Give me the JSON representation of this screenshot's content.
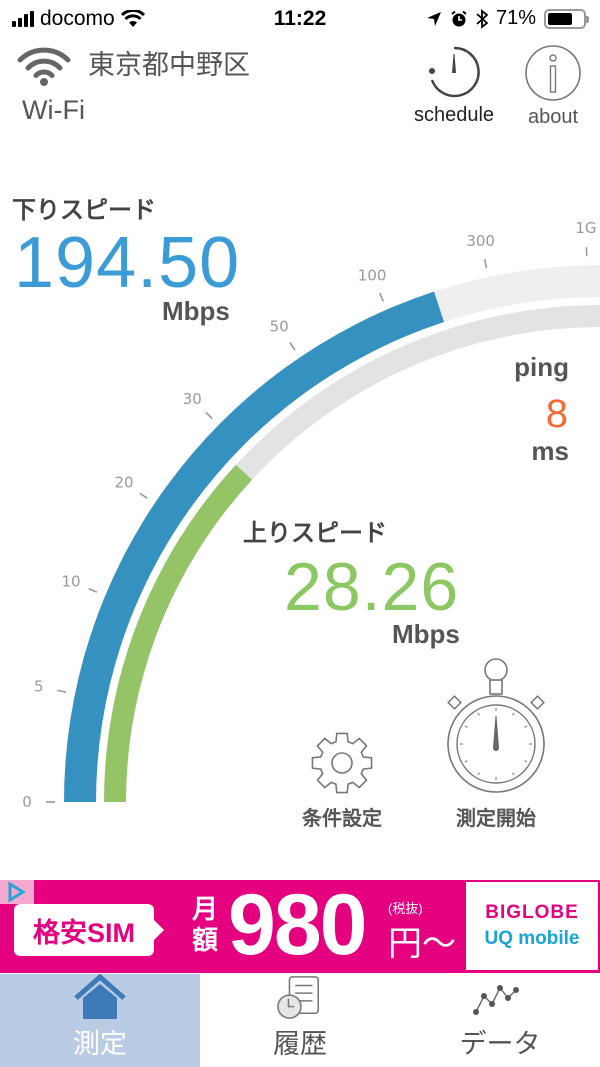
{
  "status_bar": {
    "carrier": "docomo",
    "time": "11:22",
    "battery": "71%",
    "battery_level": 0.71,
    "icons": [
      "signal-icon",
      "wifi-icon",
      "location-arrow-icon",
      "alarm-icon",
      "bluetooth-icon",
      "battery-icon"
    ]
  },
  "header": {
    "location": "東京都中野区",
    "network_type": "Wi-Fi",
    "network_icon": "wifi-icon",
    "schedule_label": "schedule",
    "about_label": "about"
  },
  "download": {
    "title": "下りスピード",
    "value": "194.50",
    "unit": "Mbps",
    "numeric": 194.5,
    "color": "#3591c0"
  },
  "upload": {
    "title": "上りスピード",
    "value": "28.26",
    "unit": "Mbps",
    "numeric": 28.26,
    "color": "#94c466"
  },
  "ping": {
    "title": "ping",
    "value": "8",
    "unit": "ms"
  },
  "gauge": {
    "ticks": [
      {
        "label": "0",
        "value": 0
      },
      {
        "label": "5",
        "value": 5
      },
      {
        "label": "10",
        "value": 10
      },
      {
        "label": "20",
        "value": 20
      },
      {
        "label": "30",
        "value": 30
      },
      {
        "label": "50",
        "value": 50
      },
      {
        "label": "100",
        "value": 100
      },
      {
        "label": "300",
        "value": 300
      },
      {
        "label": "1G",
        "value": 1000
      }
    ],
    "track_outer_color": "#efefef",
    "track_inner_color": "#e3e3e3"
  },
  "actions": {
    "settings_label": "条件設定",
    "start_label": "測定開始"
  },
  "ad": {
    "left_text": "格安SIM",
    "month_text": "月額",
    "price": "980",
    "tax_note": "(税抜)",
    "yen": "円〜",
    "brand_line1": "BIGLOBE",
    "brand_line2": "UQ mobile",
    "color": "#e4007f"
  },
  "tabs": [
    {
      "label": "測定",
      "icon": "home-icon",
      "active": true
    },
    {
      "label": "履歴",
      "icon": "history-icon",
      "active": false
    },
    {
      "label": "データ",
      "icon": "chart-icon",
      "active": false
    }
  ]
}
